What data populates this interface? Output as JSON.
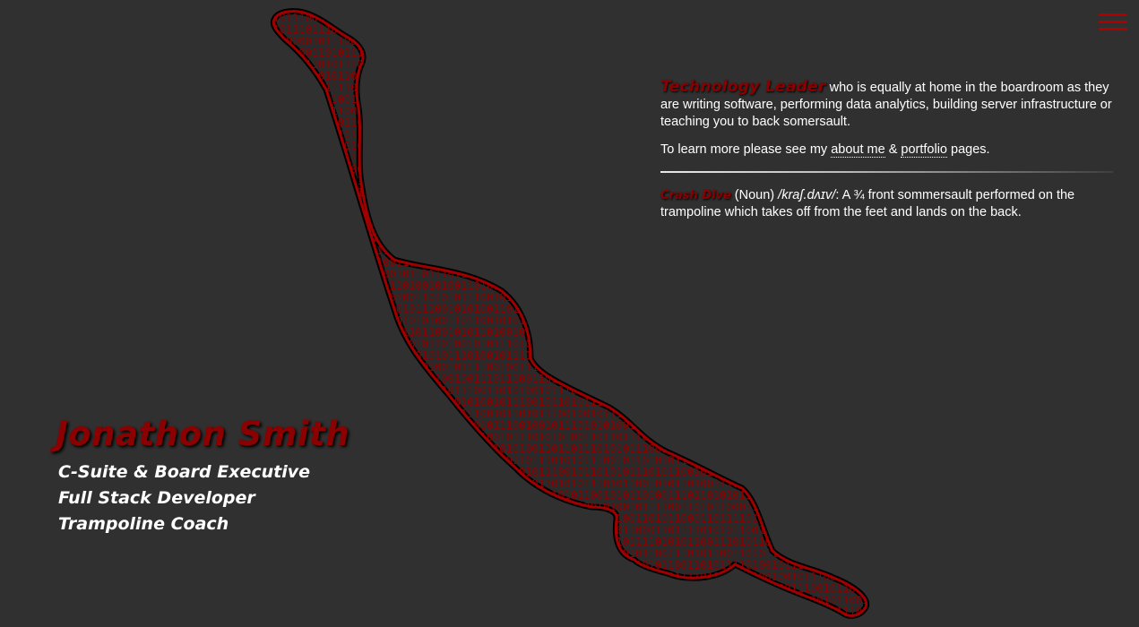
{
  "header": {
    "menu_icon": "hamburger-menu-icon",
    "accent_color": "#8b0000"
  },
  "hero": {
    "name": "Jonathon Smith",
    "roles": [
      "C-Suite & Board Executive",
      "Full Stack Developer",
      "Trampoline Coach"
    ],
    "silhouette_binary": "1010111001011101110000101110011010111010111001011010111100101001011110011010110001101111010101100111010110011010111101001011100100101110011100101101010110011011101001001100100101101110100101001101010111001010100110110010101101001010111010010111100100111011100110101001011100101101011100100101110101010011011011101010111001011010101110101100101011010011101101010110100111011001011101001010"
  },
  "intro": {
    "highlight": "Technology Leader",
    "text": " who is equally at home in the boardroom as they are writing software, performing data analytics, building server infrastructure or teaching you to back somersault.",
    "learn_prefix": "To learn more please see my ",
    "about_link": "about me",
    "amp": " & ",
    "portfolio_link": "portfolio",
    "learn_suffix": " pages."
  },
  "definition": {
    "term": "Crash Dive",
    "pos": " (Noun) ",
    "ipa": "/kraʃ.dʌɪv/",
    "text": ": A ¾ front sommersault performed on the trampoline which takes off from the feet and lands on the back."
  }
}
